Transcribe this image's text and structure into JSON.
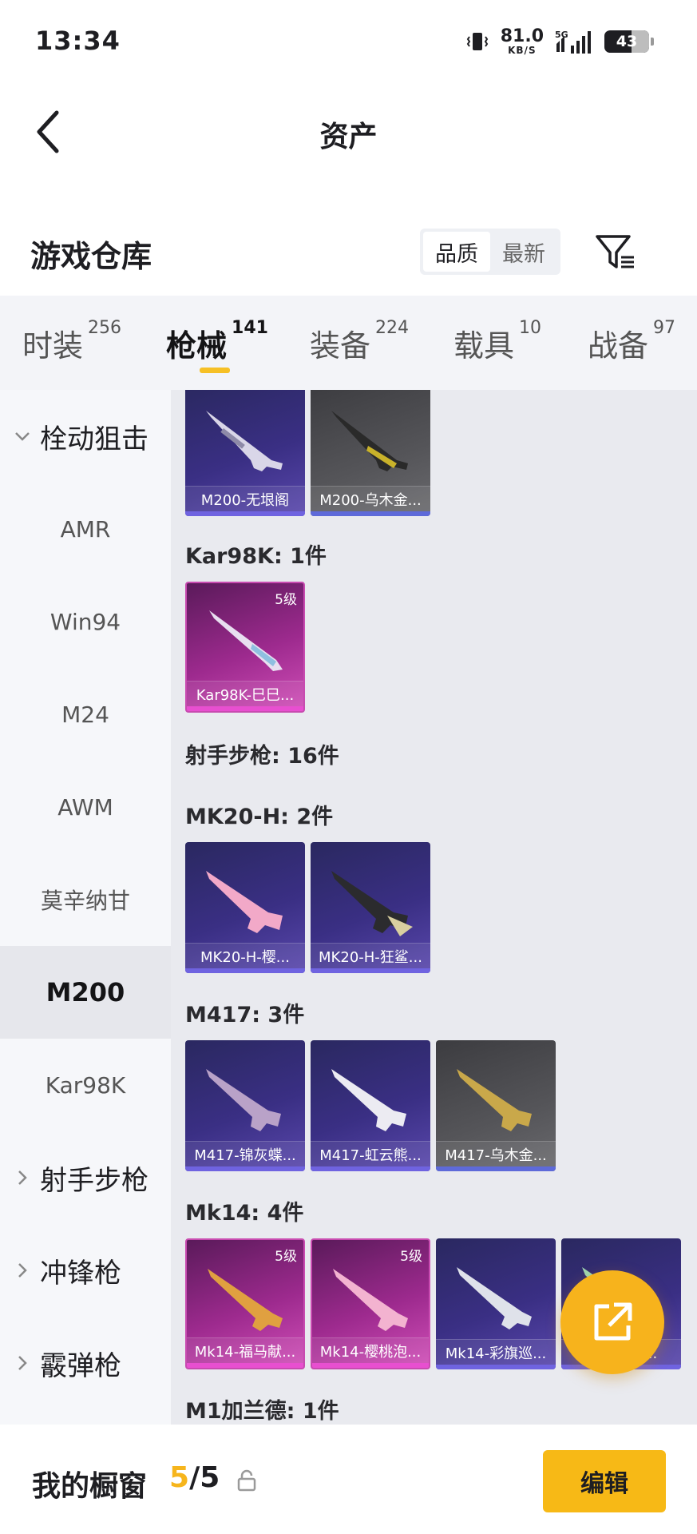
{
  "status_bar": {
    "time": "13:34",
    "speed_value": "81.0",
    "speed_unit": "KB/S",
    "network": "5G",
    "battery": "43"
  },
  "header": {
    "title": "资产"
  },
  "warehouse": {
    "title": "游戏仓库",
    "sort_options": [
      "品质",
      "最新"
    ],
    "sort_selected": "品质"
  },
  "tabs": [
    {
      "label": "时装",
      "count": "256"
    },
    {
      "label": "枪械",
      "count": "141",
      "active": true
    },
    {
      "label": "装备",
      "count": "224"
    },
    {
      "label": "载具",
      "count": "10"
    },
    {
      "label": "战备",
      "count": "97"
    }
  ],
  "sidebar": {
    "items": [
      {
        "label": "栓动狙击",
        "type": "group",
        "expanded": true
      },
      {
        "label": "AMR"
      },
      {
        "label": "Win94"
      },
      {
        "label": "M24"
      },
      {
        "label": "AWM"
      },
      {
        "label": "莫辛纳甘"
      },
      {
        "label": "M200",
        "selected": true
      },
      {
        "label": "Kar98K"
      },
      {
        "label": "射手步枪",
        "type": "group",
        "expanded": false
      },
      {
        "label": "冲锋枪",
        "type": "group",
        "expanded": false
      },
      {
        "label": "霰弹枪",
        "type": "group",
        "expanded": false
      }
    ]
  },
  "content": {
    "m200_items": [
      "M200-无垠阁",
      "M200-乌木金..."
    ],
    "kar98k_label": "Kar98K: 1件",
    "kar98k_items": [
      {
        "name": "Kar98K-巳巳...",
        "level": "5级"
      }
    ],
    "dmr_label": "射手步枪: 16件",
    "mk20_label": "MK20-H: 2件",
    "mk20_items": [
      "MK20-H-樱...",
      "MK20-H-狂鲨..."
    ],
    "m417_label": "M417: 3件",
    "m417_items": [
      "M417-锦灰蝶...",
      "M417-虹云熊...",
      "M417-乌木金..."
    ],
    "mk14_label": "Mk14: 4件",
    "mk14_items": [
      {
        "name": "Mk14-福马献...",
        "level": "5级"
      },
      {
        "name": "Mk14-樱桃泡...",
        "level": "5级"
      },
      {
        "name": "Mk14-彩旗巡..."
      },
      {
        "name": "Mk14-星..."
      }
    ],
    "m1_label": "M1加兰德: 1件"
  },
  "bottom_bar": {
    "title": "我的橱窗",
    "current": "5",
    "separator": "/",
    "total": "5",
    "edit_label": "编辑"
  },
  "colors": {
    "accent": "#f7b916",
    "selected_bg": "#e6e7ec",
    "purple_card": "#3a2f84",
    "pink_card": "#9d2a8e",
    "grey_card": "#555559"
  }
}
